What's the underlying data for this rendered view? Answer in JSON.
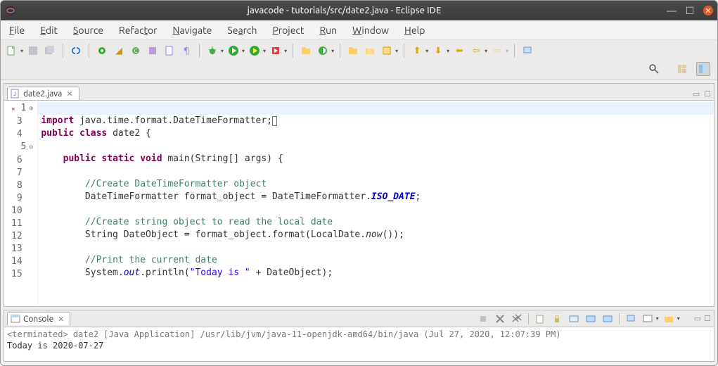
{
  "window": {
    "title": "javacode - tutorials/src/date2.java - Eclipse IDE"
  },
  "menu": {
    "file": "File",
    "edit": "Edit",
    "source": "Source",
    "refactor": "Refactor",
    "navigate": "Navigate",
    "search": "Search",
    "project": "Project",
    "run": "Run",
    "window": "Window",
    "help": "Help"
  },
  "editor": {
    "tab_label": "date2.java",
    "lines": {
      "l1": "import java.time.format.DateTimeFormatter;",
      "l3": "public class date2 {",
      "l4": "",
      "l5": "    public static void main(String[] args) {",
      "l6": "",
      "l7": "        //Create DateTimeFormatter object",
      "l8": "        DateTimeFormatter format_object = DateTimeFormatter.ISO_DATE;",
      "l9": "",
      "l10": "        //Create string object to read the local date",
      "l11": "        String DateObject = format_object.format(LocalDate.now());",
      "l12": "",
      "l13": "        //Print the current date",
      "l14": "        System.out.println(\"Today is \" + DateObject);",
      "l15": ""
    },
    "line_numbers": [
      "1",
      "3",
      "4",
      "5",
      "6",
      "7",
      "8",
      "9",
      "10",
      "11",
      "12",
      "13",
      "14",
      "15"
    ]
  },
  "console": {
    "tab_label": "Console",
    "status": "<terminated> date2 [Java Application] /usr/lib/jvm/java-11-openjdk-amd64/bin/java (Jul 27, 2020, 12:07:39 PM)",
    "output": "Today is 2020-07-27"
  }
}
